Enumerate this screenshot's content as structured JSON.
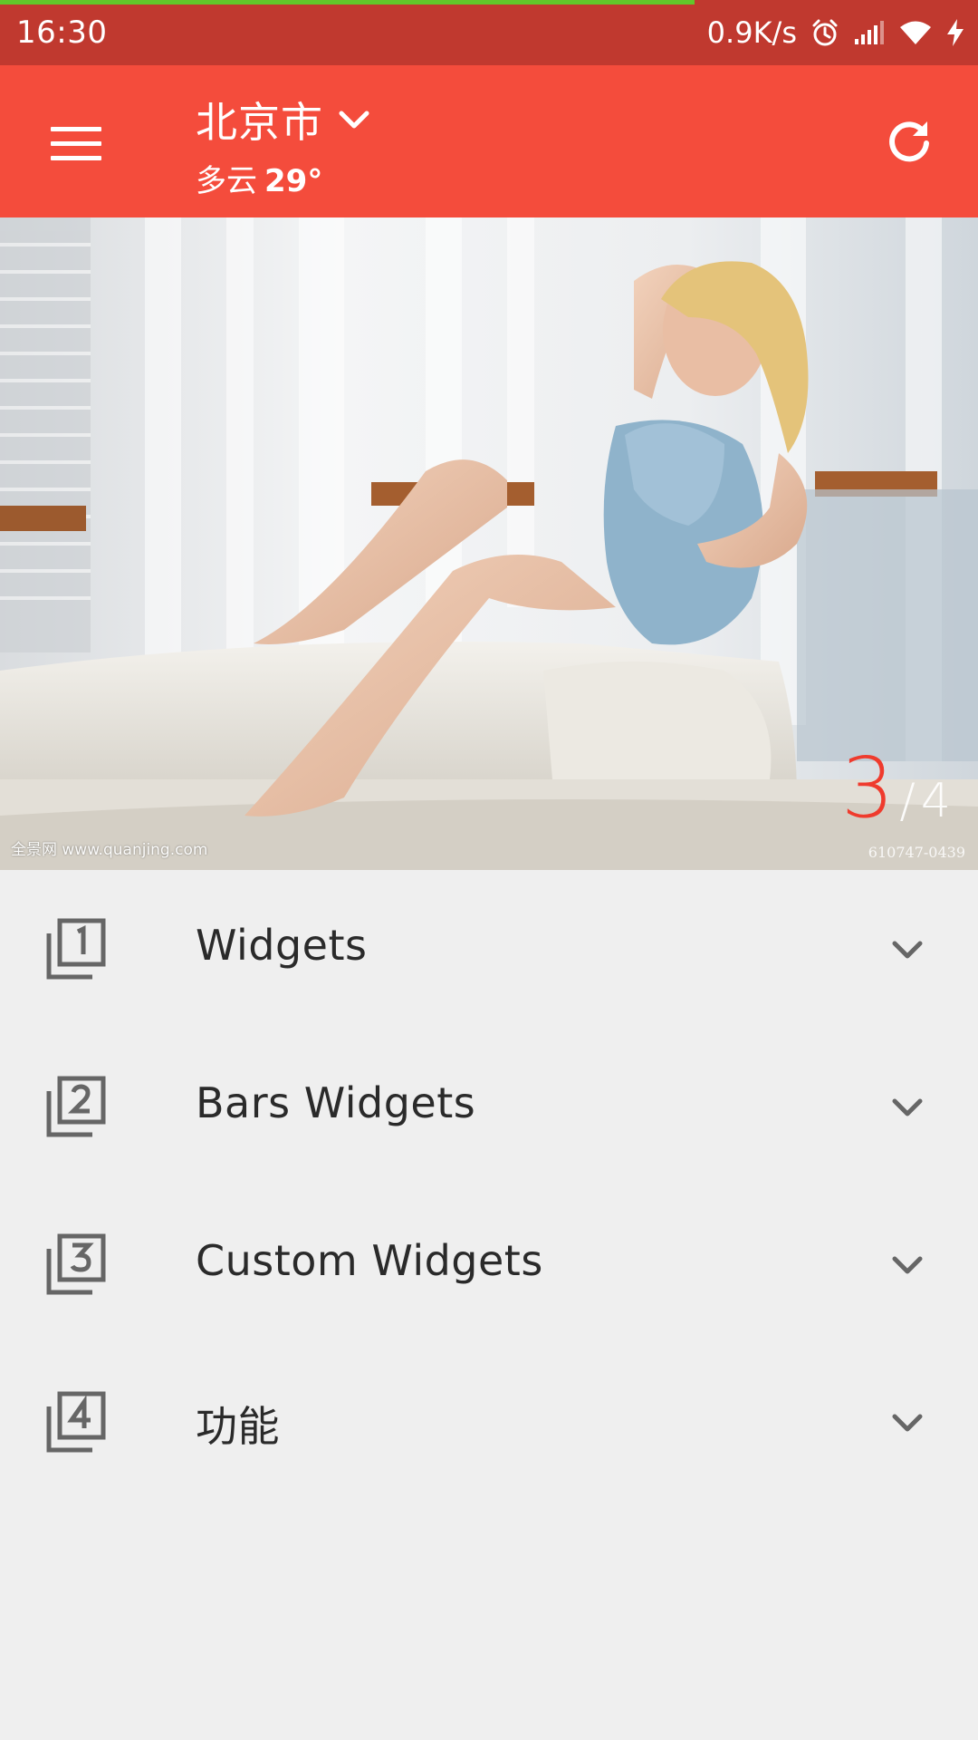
{
  "status_bar": {
    "time": "16:30",
    "network_speed": "0.9K/s",
    "icons": [
      "alarm-icon",
      "signal-icon",
      "wifi-icon",
      "charging-icon"
    ],
    "colors": {
      "background": "#c0392f",
      "progress": "#62c62a"
    },
    "progress": 0.71
  },
  "app_bar": {
    "city": "北京市",
    "weather": "多云",
    "temperature": "29°",
    "icons": [
      "menu-icon",
      "chevron-down-icon",
      "refresh-icon"
    ],
    "colors": {
      "background": "#f44c3c"
    }
  },
  "banner": {
    "watermark": "全景网 www.quanjing.com",
    "image_code": "610747-0439",
    "current_page": "3",
    "separator": "/",
    "total_pages": "4",
    "colors": {
      "indicator_current": "#ef3b2d"
    }
  },
  "menu": {
    "items": [
      {
        "icon": "filter-1-icon",
        "label": "Widgets"
      },
      {
        "icon": "filter-2-icon",
        "label": "Bars Widgets"
      },
      {
        "icon": "filter-3-icon",
        "label": "Custom Widgets"
      },
      {
        "icon": "filter-4-icon",
        "label": "功能"
      }
    ],
    "expand_icon": "chevron-down-icon"
  }
}
